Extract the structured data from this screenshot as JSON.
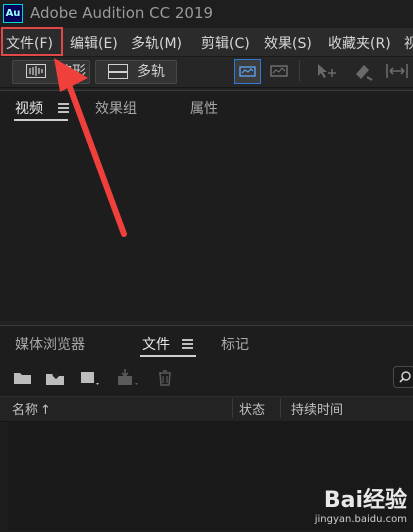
{
  "app": {
    "logo_text": "Au",
    "title": "Adobe Audition CC 2019"
  },
  "menu": {
    "items": [
      "文件(F)",
      "编辑(E)",
      "多轨(M)",
      "剪辑(C)",
      "效果(S)",
      "收藏夹(R)",
      "视"
    ],
    "highlighted_index": 0
  },
  "toolbar": {
    "waveform_label": "波形",
    "multitrack_label": "多轨"
  },
  "top_panel": {
    "tabs": [
      "视频",
      "效果组",
      "属性"
    ],
    "active_tab": 0
  },
  "bottom_panel": {
    "tabs": [
      "媒体浏览器",
      "文件",
      "标记"
    ],
    "active_tab": 1,
    "columns": [
      "名称",
      "状态",
      "持续时间"
    ],
    "sort_indicator": "↑"
  },
  "annotation": {
    "arrow_color": "#f0403c",
    "box_color": "#e04848"
  },
  "watermark": {
    "brand": "Bai经验",
    "url": "jingyan.baidu.com"
  },
  "icons": {
    "waveform": "waveform-icon",
    "multitrack": "multitrack-icon",
    "open_folder": "open-folder-icon",
    "import": "import-icon",
    "new_file": "new-file-icon",
    "insert": "insert-icon",
    "delete": "trash-icon",
    "search": "search-icon"
  }
}
